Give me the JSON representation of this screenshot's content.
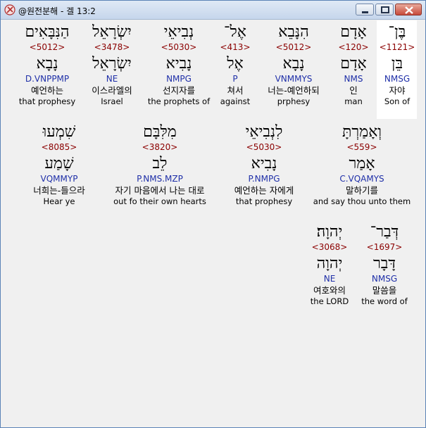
{
  "window": {
    "title": "@원전분해 - 겔 13:2"
  },
  "rows": [
    [
      {
        "heb": "בֶּן־",
        "strong": "<1121>",
        "lemma": "בֵּן",
        "parse": "NMSG",
        "kor": "자야",
        "eng": "Son of",
        "selected": true
      },
      {
        "heb": "אָדָם",
        "strong": "<120>",
        "lemma": "אָדָם",
        "parse": "NMS",
        "kor": "인",
        "eng": "man"
      },
      {
        "heb": "הִנָּבֵא",
        "strong": "<5012>",
        "lemma": "נָבָא",
        "parse": "VNMMYS",
        "kor": "너는-예언하되",
        "eng": "prphesy"
      },
      {
        "heb": "אֶל־",
        "strong": "<413>",
        "lemma": "אֶל",
        "parse": "P",
        "kor": "쳐서",
        "eng": "against"
      },
      {
        "heb": "נְבִיאֵי",
        "strong": "<5030>",
        "lemma": "נָבִיא",
        "parse": "NMPG",
        "kor": "선지자를",
        "eng": "the prophets of"
      },
      {
        "heb": "יִשְׂרָאֵל",
        "strong": "<3478>",
        "lemma": "יִשְׂרָאֵל",
        "parse": "NE",
        "kor": "이스라엘의",
        "eng": "Israel"
      },
      {
        "heb": "הַנִּבָּאִים",
        "strong": "<5012>",
        "lemma": "נָבָא",
        "parse": "D.VNPPMP",
        "kor": "예언하는",
        "eng": "that prophesy"
      }
    ],
    [
      {
        "heb": "וְאָמַרְתָּ",
        "strong": "<559>",
        "lemma": "אָמַר",
        "parse": "C.VQAMYS",
        "kor": "말하기를",
        "eng": "and say thou unto them"
      },
      {
        "heb": "לִנְבִיאֵי",
        "strong": "<5030>",
        "lemma": "נָבִיא",
        "parse": "P.NMPG",
        "kor": "예언하는 자에게",
        "eng": "that prophesy"
      },
      {
        "heb": "מִלִּבָּם",
        "strong": "<3820>",
        "lemma": "לֵב",
        "parse": "P.NMS.MZP",
        "kor": "자기 마음에서 나는 대로",
        "eng": "out fo their own hearts"
      },
      {
        "heb": "שִׁמְעוּ",
        "strong": "<8085>",
        "lemma": "שָׁמַע",
        "parse": "VQMMYP",
        "kor": "너희는-들으라",
        "eng": "Hear ye"
      }
    ],
    [
      {
        "heb": "דְּבַר־",
        "strong": "<1697>",
        "lemma": "דָּבָר",
        "parse": "NMSG",
        "kor": "말씀을",
        "eng": "the word of"
      },
      {
        "heb": "יְהוָה׃",
        "strong": "<3068>",
        "lemma": "יְהוָה",
        "parse": "NE",
        "kor": "여호와의",
        "eng": "the LORD"
      }
    ]
  ]
}
